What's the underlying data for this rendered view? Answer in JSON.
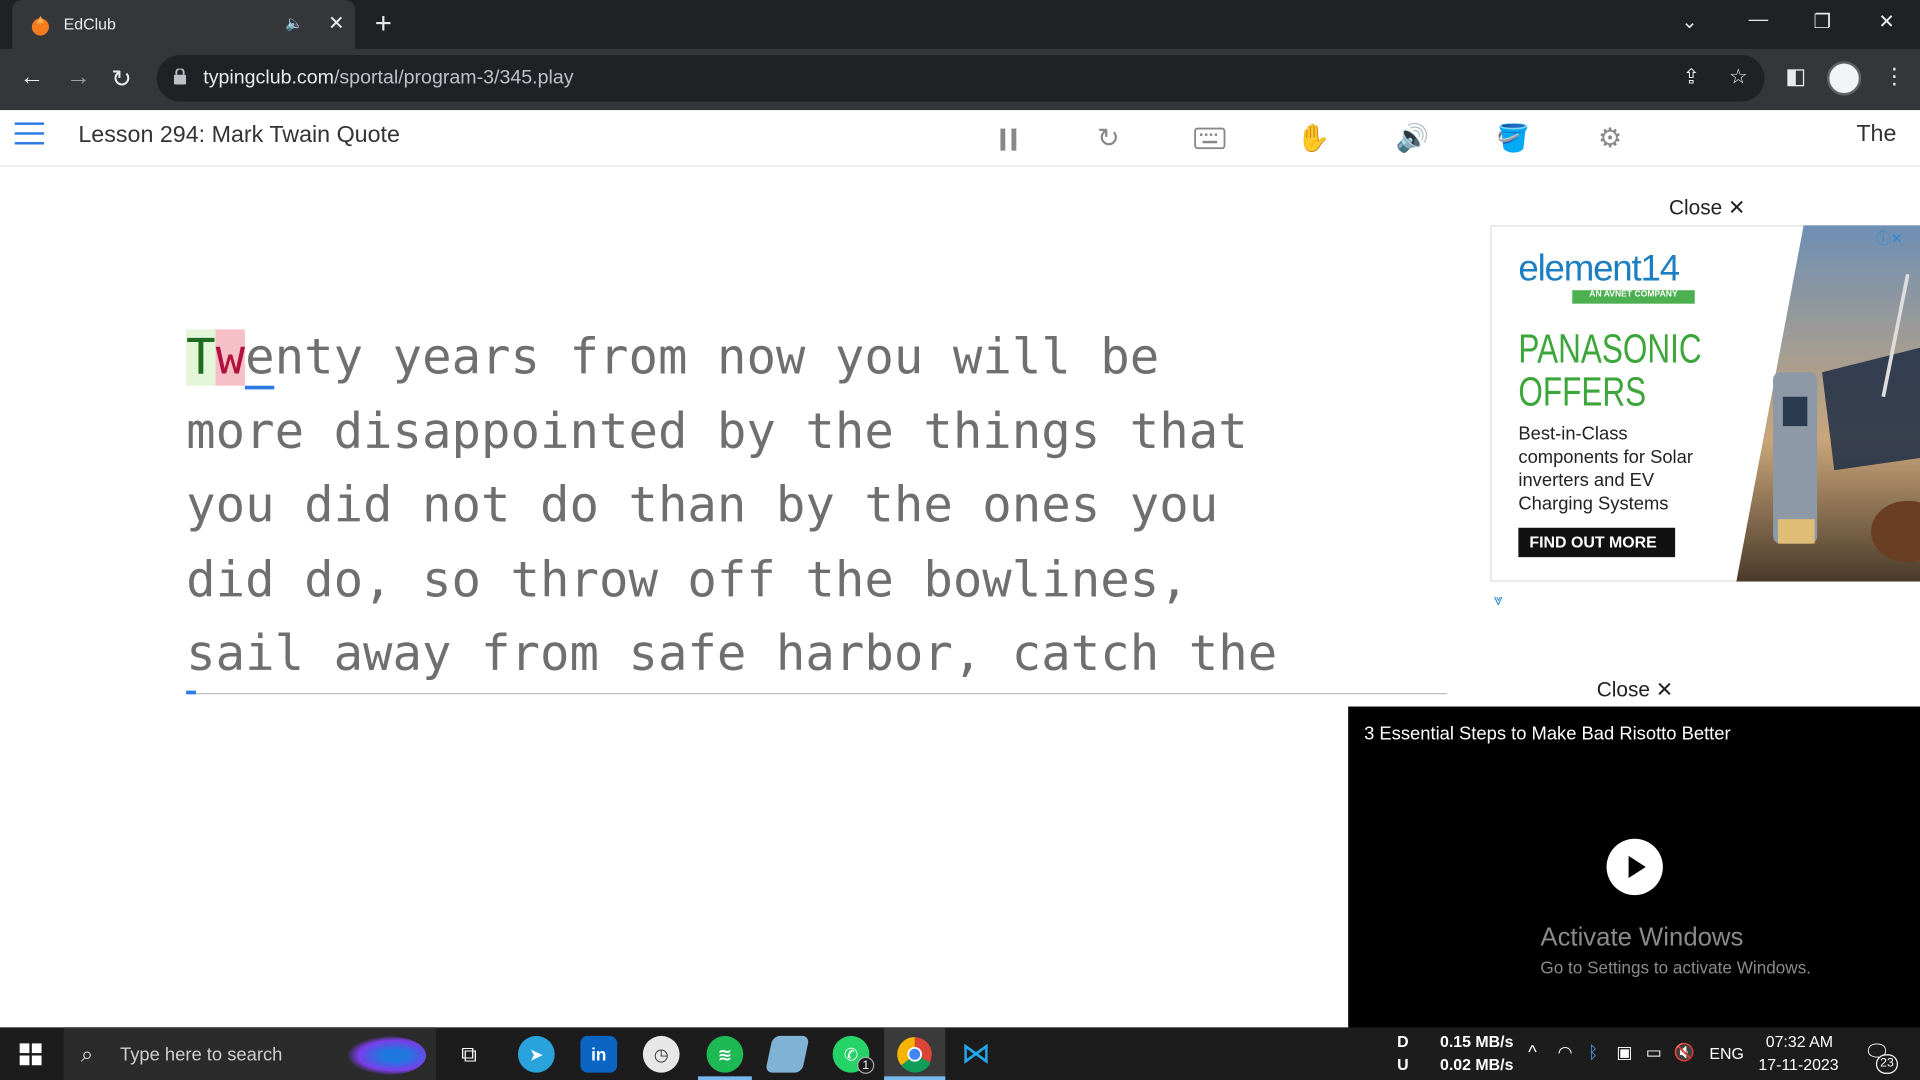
{
  "browser": {
    "tab_title": "EdClub",
    "url_host": "typingclub.com",
    "url_path": "/sportal/program-3/345.play"
  },
  "app": {
    "lesson_title": "Lesson 294: Mark Twain Quote",
    "header_right": "The",
    "controls": [
      "pause-icon",
      "restart-icon",
      "keyboard-icon",
      "hand-icon",
      "sound-icon",
      "theme-icon",
      "settings-icon"
    ]
  },
  "typing": {
    "typed_correct": "T",
    "typed_wrong": "w",
    "cursor_char": "e",
    "line1_rest": "nty years from now you will be",
    "lines": [
      "more disappointed by the things that",
      "you did not do than by the ones you",
      "did do, so throw off the bowlines,",
      "sail away from safe harbor, catch the"
    ],
    "colors": {
      "correct_bg": "#e3f6d8",
      "wrong_bg": "#f6c0c8",
      "cursor": "#2d7be5"
    }
  },
  "ads": {
    "close_label": "Close",
    "banner": {
      "brand": "element14",
      "brand_sub": "AN AVNET COMPANY",
      "headline_1": "PANASONIC",
      "headline_2": "OFFERS",
      "body": "Best-in-Class components for Solar inverters and EV Charging Systems",
      "cta": "FIND OUT MORE"
    },
    "video": {
      "title": "3 Essential Steps to Make Bad Risotto Better",
      "watermark_1": "Activate Windows",
      "watermark_2": "Go to Settings to activate Windows."
    }
  },
  "taskbar": {
    "search_placeholder": "Type here to search",
    "net_down_label": "D",
    "net_up_label": "U",
    "net_down": "0.15 MB/s",
    "net_up": "0.02 MB/s",
    "language": "ENG",
    "time": "07:32 AM",
    "date": "17-11-2023",
    "notifications": "23",
    "whatsapp_badge": "1"
  }
}
